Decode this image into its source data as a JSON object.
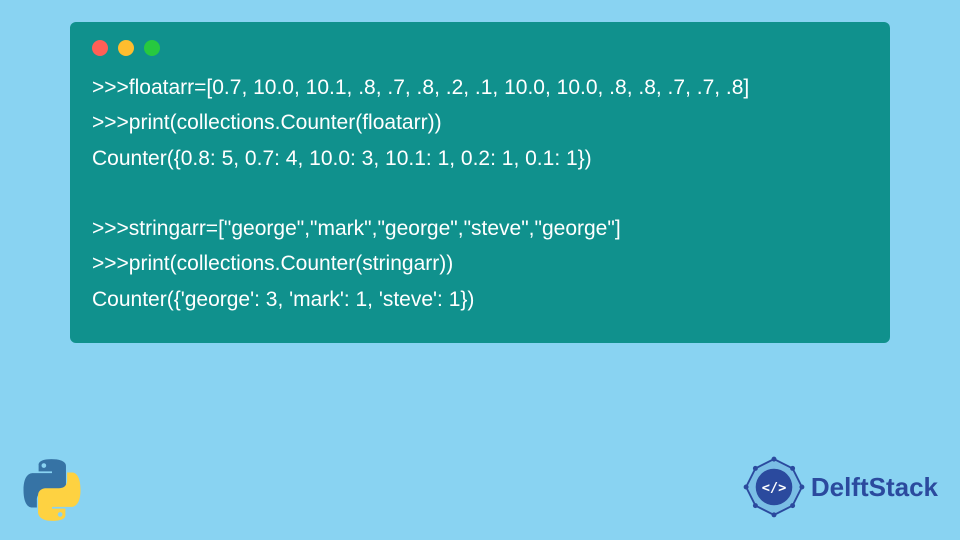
{
  "code": {
    "lines": [
      ">>>floatarr=[0.7, 10.0, 10.1, .8, .7, .8, .2, .1, 10.0, 10.0, .8, .8, .7, .7, .8]",
      ">>>print(collections.Counter(floatarr))",
      "Counter({0.8: 5, 0.7: 4, 10.0: 3, 10.1: 1, 0.2: 1, 0.1: 1})",
      "",
      ">>>stringarr=[\"george\",\"mark\",\"george\",\"steve\",\"george\"]",
      ">>>print(collections.Counter(stringarr))",
      "Counter({'george': 3, 'mark': 1, 'steve': 1})"
    ]
  },
  "branding": {
    "site_name": "DelftStack"
  },
  "colors": {
    "background": "#89d3f2",
    "code_bg": "#10918d",
    "code_text": "#ffffff",
    "brand_blue": "#2b4a9e"
  }
}
